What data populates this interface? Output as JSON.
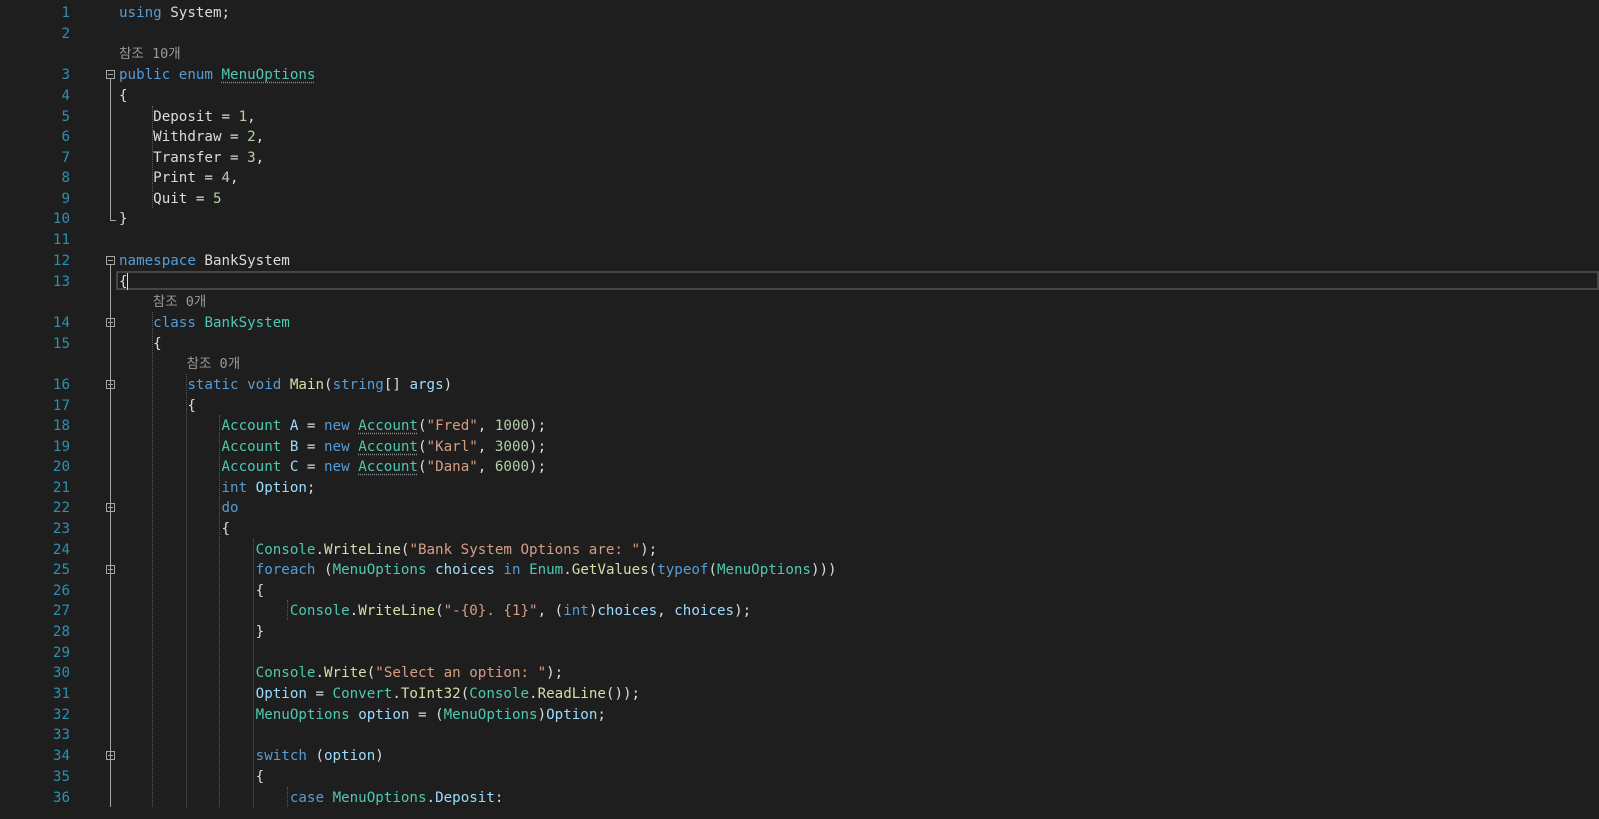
{
  "editor": {
    "colors": {
      "background": "#1e1e1e",
      "line_number": "#2b91af",
      "keyword": "#569cd6",
      "type": "#4ec9b0",
      "string": "#d69d85",
      "number": "#b5cea8",
      "plain": "#dcdcdc",
      "codelens": "#999999"
    },
    "lenses": [
      {
        "text": "참조 10개"
      },
      {
        "text": "참조 0개"
      },
      {
        "text": "참조 0개"
      }
    ],
    "lines": [
      {
        "num": "1",
        "tokens": [
          {
            "t": "using",
            "c": "kw"
          },
          {
            "t": " System;",
            "c": "pl"
          }
        ]
      },
      {
        "num": "2",
        "tokens": []
      },
      {
        "num": "3",
        "tokens": [
          {
            "t": "public",
            "c": "kw"
          },
          {
            "t": " ",
            "c": "pl"
          },
          {
            "t": "enum",
            "c": "kw"
          },
          {
            "t": " ",
            "c": "pl"
          },
          {
            "t": "MenuOptions",
            "c": "ty",
            "sq": true
          }
        ]
      },
      {
        "num": "4",
        "tokens": [
          {
            "t": "{",
            "c": "pl"
          }
        ]
      },
      {
        "num": "5",
        "tokens": [
          {
            "t": "    Deposit = ",
            "c": "pl"
          },
          {
            "t": "1",
            "c": "nu"
          },
          {
            "t": ",",
            "c": "pl"
          }
        ]
      },
      {
        "num": "6",
        "tokens": [
          {
            "t": "    Withdraw = ",
            "c": "pl"
          },
          {
            "t": "2",
            "c": "nu"
          },
          {
            "t": ",",
            "c": "pl"
          }
        ]
      },
      {
        "num": "7",
        "tokens": [
          {
            "t": "    Transfer = ",
            "c": "pl"
          },
          {
            "t": "3",
            "c": "nu"
          },
          {
            "t": ",",
            "c": "pl"
          }
        ]
      },
      {
        "num": "8",
        "tokens": [
          {
            "t": "    Print = ",
            "c": "pl"
          },
          {
            "t": "4",
            "c": "nu"
          },
          {
            "t": ",",
            "c": "pl"
          }
        ]
      },
      {
        "num": "9",
        "tokens": [
          {
            "t": "    Quit = ",
            "c": "pl"
          },
          {
            "t": "5",
            "c": "nu"
          }
        ]
      },
      {
        "num": "10",
        "tokens": [
          {
            "t": "}",
            "c": "pl"
          }
        ]
      },
      {
        "num": "11",
        "tokens": []
      },
      {
        "num": "12",
        "tokens": [
          {
            "t": "namespace",
            "c": "kw"
          },
          {
            "t": " BankSystem",
            "c": "pl"
          }
        ]
      },
      {
        "num": "13",
        "tokens": [
          {
            "t": "{",
            "c": "pl"
          }
        ]
      },
      {
        "num": "14",
        "tokens": [
          {
            "t": "    ",
            "c": "pl"
          },
          {
            "t": "class",
            "c": "kw"
          },
          {
            "t": " ",
            "c": "pl"
          },
          {
            "t": "BankSystem",
            "c": "ty"
          }
        ]
      },
      {
        "num": "15",
        "tokens": [
          {
            "t": "    {",
            "c": "pl"
          }
        ]
      },
      {
        "num": "16",
        "tokens": [
          {
            "t": "        ",
            "c": "pl"
          },
          {
            "t": "static",
            "c": "kw"
          },
          {
            "t": " ",
            "c": "pl"
          },
          {
            "t": "void",
            "c": "kw"
          },
          {
            "t": " ",
            "c": "pl"
          },
          {
            "t": "Main",
            "c": "mt"
          },
          {
            "t": "(",
            "c": "pl"
          },
          {
            "t": "string",
            "c": "kw"
          },
          {
            "t": "[] ",
            "c": "pl"
          },
          {
            "t": "args",
            "c": "ct"
          },
          {
            "t": ")",
            "c": "pl"
          }
        ]
      },
      {
        "num": "17",
        "tokens": [
          {
            "t": "        {",
            "c": "pl"
          }
        ]
      },
      {
        "num": "18",
        "tokens": [
          {
            "t": "            ",
            "c": "pl"
          },
          {
            "t": "Account",
            "c": "ty"
          },
          {
            "t": " ",
            "c": "pl"
          },
          {
            "t": "A",
            "c": "ct"
          },
          {
            "t": " = ",
            "c": "pl"
          },
          {
            "t": "new",
            "c": "kw"
          },
          {
            "t": " ",
            "c": "pl"
          },
          {
            "t": "Account",
            "c": "ty",
            "sq": true
          },
          {
            "t": "(",
            "c": "pl"
          },
          {
            "t": "\"Fred\"",
            "c": "st"
          },
          {
            "t": ", ",
            "c": "pl"
          },
          {
            "t": "1000",
            "c": "nu"
          },
          {
            "t": ");",
            "c": "pl"
          }
        ]
      },
      {
        "num": "19",
        "tokens": [
          {
            "t": "            ",
            "c": "pl"
          },
          {
            "t": "Account",
            "c": "ty"
          },
          {
            "t": " ",
            "c": "pl"
          },
          {
            "t": "B",
            "c": "ct"
          },
          {
            "t": " = ",
            "c": "pl"
          },
          {
            "t": "new",
            "c": "kw"
          },
          {
            "t": " ",
            "c": "pl"
          },
          {
            "t": "Account",
            "c": "ty",
            "sq": true
          },
          {
            "t": "(",
            "c": "pl"
          },
          {
            "t": "\"Karl\"",
            "c": "st"
          },
          {
            "t": ", ",
            "c": "pl"
          },
          {
            "t": "3000",
            "c": "nu"
          },
          {
            "t": ");",
            "c": "pl"
          }
        ]
      },
      {
        "num": "20",
        "tokens": [
          {
            "t": "            ",
            "c": "pl"
          },
          {
            "t": "Account",
            "c": "ty"
          },
          {
            "t": " ",
            "c": "pl"
          },
          {
            "t": "C",
            "c": "ct"
          },
          {
            "t": " = ",
            "c": "pl"
          },
          {
            "t": "new",
            "c": "kw"
          },
          {
            "t": " ",
            "c": "pl"
          },
          {
            "t": "Account",
            "c": "ty",
            "sq": true
          },
          {
            "t": "(",
            "c": "pl"
          },
          {
            "t": "\"Dana\"",
            "c": "st"
          },
          {
            "t": ", ",
            "c": "pl"
          },
          {
            "t": "6000",
            "c": "nu"
          },
          {
            "t": ");",
            "c": "pl"
          }
        ]
      },
      {
        "num": "21",
        "tokens": [
          {
            "t": "            ",
            "c": "pl"
          },
          {
            "t": "int",
            "c": "kw"
          },
          {
            "t": " ",
            "c": "pl"
          },
          {
            "t": "Option",
            "c": "ct"
          },
          {
            "t": ";",
            "c": "pl"
          }
        ]
      },
      {
        "num": "22",
        "tokens": [
          {
            "t": "            ",
            "c": "pl"
          },
          {
            "t": "do",
            "c": "kw"
          }
        ]
      },
      {
        "num": "23",
        "tokens": [
          {
            "t": "            {",
            "c": "pl"
          }
        ]
      },
      {
        "num": "24",
        "tokens": [
          {
            "t": "                ",
            "c": "pl"
          },
          {
            "t": "Console",
            "c": "ty"
          },
          {
            "t": ".",
            "c": "pl"
          },
          {
            "t": "WriteLine",
            "c": "mt"
          },
          {
            "t": "(",
            "c": "pl"
          },
          {
            "t": "\"Bank System Options are: \"",
            "c": "st"
          },
          {
            "t": ");",
            "c": "pl"
          }
        ]
      },
      {
        "num": "25",
        "tokens": [
          {
            "t": "                ",
            "c": "pl"
          },
          {
            "t": "foreach",
            "c": "kw"
          },
          {
            "t": " (",
            "c": "pl"
          },
          {
            "t": "MenuOptions",
            "c": "ty"
          },
          {
            "t": " ",
            "c": "pl"
          },
          {
            "t": "choices",
            "c": "ct"
          },
          {
            "t": " ",
            "c": "pl"
          },
          {
            "t": "in",
            "c": "kw"
          },
          {
            "t": " ",
            "c": "pl"
          },
          {
            "t": "Enum",
            "c": "ty"
          },
          {
            "t": ".",
            "c": "pl"
          },
          {
            "t": "GetValues",
            "c": "mt"
          },
          {
            "t": "(",
            "c": "pl"
          },
          {
            "t": "typeof",
            "c": "kw"
          },
          {
            "t": "(",
            "c": "pl"
          },
          {
            "t": "MenuOptions",
            "c": "ty"
          },
          {
            "t": ")))",
            "c": "pl"
          }
        ]
      },
      {
        "num": "26",
        "tokens": [
          {
            "t": "                {",
            "c": "pl"
          }
        ]
      },
      {
        "num": "27",
        "tokens": [
          {
            "t": "                    ",
            "c": "pl"
          },
          {
            "t": "Console",
            "c": "ty"
          },
          {
            "t": ".",
            "c": "pl"
          },
          {
            "t": "WriteLine",
            "c": "mt"
          },
          {
            "t": "(",
            "c": "pl"
          },
          {
            "t": "\"-{0}. {1}\"",
            "c": "st"
          },
          {
            "t": ", (",
            "c": "pl"
          },
          {
            "t": "int",
            "c": "kw"
          },
          {
            "t": ")",
            "c": "pl"
          },
          {
            "t": "choices",
            "c": "ct"
          },
          {
            "t": ", ",
            "c": "pl"
          },
          {
            "t": "choices",
            "c": "ct"
          },
          {
            "t": ");",
            "c": "pl"
          }
        ]
      },
      {
        "num": "28",
        "tokens": [
          {
            "t": "                }",
            "c": "pl"
          }
        ]
      },
      {
        "num": "29",
        "tokens": []
      },
      {
        "num": "30",
        "tokens": [
          {
            "t": "                ",
            "c": "pl"
          },
          {
            "t": "Console",
            "c": "ty"
          },
          {
            "t": ".",
            "c": "pl"
          },
          {
            "t": "Write",
            "c": "mt"
          },
          {
            "t": "(",
            "c": "pl"
          },
          {
            "t": "\"Select an option: \"",
            "c": "st"
          },
          {
            "t": ");",
            "c": "pl"
          }
        ]
      },
      {
        "num": "31",
        "tokens": [
          {
            "t": "                ",
            "c": "pl"
          },
          {
            "t": "Option",
            "c": "ct"
          },
          {
            "t": " = ",
            "c": "pl"
          },
          {
            "t": "Convert",
            "c": "ty"
          },
          {
            "t": ".",
            "c": "pl"
          },
          {
            "t": "ToInt32",
            "c": "mt"
          },
          {
            "t": "(",
            "c": "pl"
          },
          {
            "t": "Console",
            "c": "ty"
          },
          {
            "t": ".",
            "c": "pl"
          },
          {
            "t": "ReadLine",
            "c": "mt"
          },
          {
            "t": "());",
            "c": "pl"
          }
        ]
      },
      {
        "num": "32",
        "tokens": [
          {
            "t": "                ",
            "c": "pl"
          },
          {
            "t": "MenuOptions",
            "c": "ty"
          },
          {
            "t": " ",
            "c": "pl"
          },
          {
            "t": "option",
            "c": "ct"
          },
          {
            "t": " = (",
            "c": "pl"
          },
          {
            "t": "MenuOptions",
            "c": "ty"
          },
          {
            "t": ")",
            "c": "pl"
          },
          {
            "t": "Option",
            "c": "ct"
          },
          {
            "t": ";",
            "c": "pl"
          }
        ]
      },
      {
        "num": "33",
        "tokens": []
      },
      {
        "num": "34",
        "tokens": [
          {
            "t": "                ",
            "c": "pl"
          },
          {
            "t": "switch",
            "c": "kw"
          },
          {
            "t": " (",
            "c": "pl"
          },
          {
            "t": "option",
            "c": "ct"
          },
          {
            "t": ")",
            "c": "pl"
          }
        ]
      },
      {
        "num": "35",
        "tokens": [
          {
            "t": "                {",
            "c": "pl"
          }
        ]
      },
      {
        "num": "36",
        "tokens": [
          {
            "t": "                    ",
            "c": "pl"
          },
          {
            "t": "case",
            "c": "kw"
          },
          {
            "t": " ",
            "c": "pl"
          },
          {
            "t": "MenuOptions",
            "c": "ty"
          },
          {
            "t": ".",
            "c": "pl"
          },
          {
            "t": "Deposit",
            "c": "ct"
          },
          {
            "t": ":",
            "c": "pl"
          }
        ]
      }
    ]
  }
}
